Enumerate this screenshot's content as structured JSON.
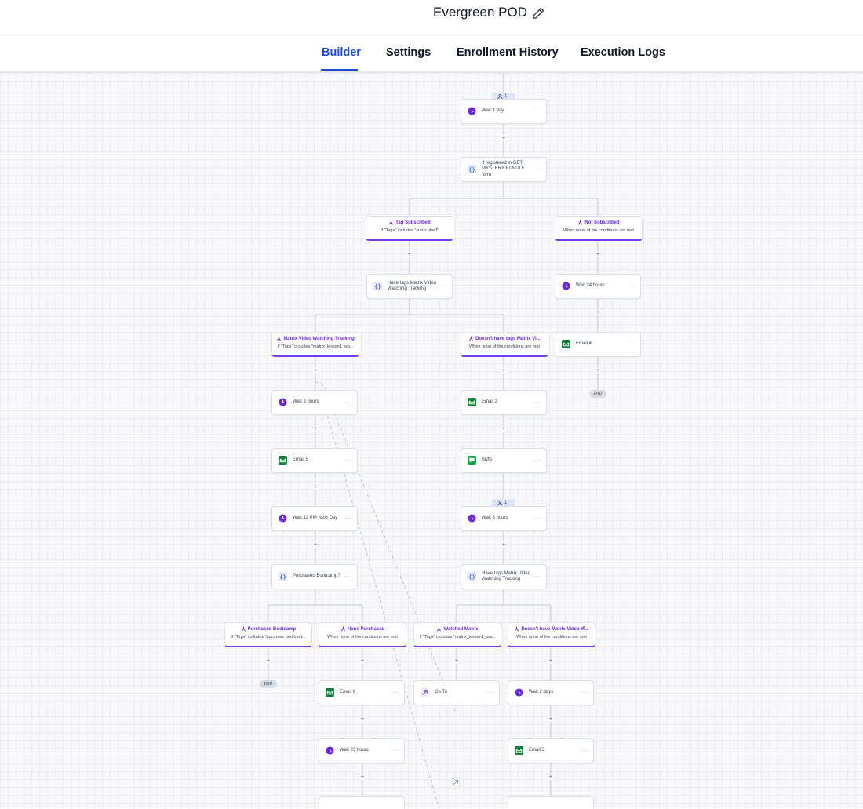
{
  "header": {
    "title": "Evergreen POD",
    "edit_icon": "pencil-icon"
  },
  "tabs": [
    {
      "label": "Builder",
      "active": true
    },
    {
      "label": "Settings",
      "active": false
    },
    {
      "label": "Enrollment History",
      "active": false
    },
    {
      "label": "Execution Logs",
      "active": false
    }
  ],
  "colors": {
    "accent": "#1d4ed8",
    "condition": "#7c3aed",
    "wait": "#6d28d9",
    "email": "#15803d",
    "sms": "#16a34a"
  },
  "workflow": {
    "badges": [
      "1",
      "1"
    ],
    "plus_symbol": "+",
    "end_label": "END",
    "more_symbol": "···",
    "nodes": {
      "wait_1_day": "Wait 1 day",
      "if_registered": "If registered in GET MYSTERY BUNDLE form",
      "have_tags_1": "Have tags Matrix Video Watching Tracking",
      "wait_24_hours": "Wait 24 hours",
      "email_4": "Email 4",
      "wait_3_hours_left": "Wait 3 hours",
      "email_5": "Email 5",
      "wait_12pm": "Wait 12 PM Next Day",
      "purchased_bootcamp_q": "Purchased Bootcamp?",
      "email_2": "Email 2",
      "sms": "SMS",
      "wait_3_hours_mid": "Wait 3 hours",
      "have_tags_2": "Have tags Matrix Video Watching Tracking",
      "email_6": "Email 6",
      "wait_23_hours": "Wait 23 hours",
      "go_to": "Go To",
      "wait_2_days": "Wait 2 days",
      "email_3": "Email 3"
    },
    "branches": {
      "tag_subscribed": {
        "title": "Tag Subscribed",
        "sub": "If \"Tags\" includes \"subscribed\""
      },
      "not_subscribed": {
        "title": "Not Subscribed",
        "sub": "When none of the conditions are met"
      },
      "matrix_tracking": {
        "title": "Matrix Video Watching Tracking",
        "sub": "If \"Tags\" includes \"matrix_lesson1_wa..."
      },
      "doesnt_have_tags": {
        "title": "Doesn't have tags Matrix Vi...",
        "sub": "When none of the conditions are met"
      },
      "purchased_bootcamp": {
        "title": "Purchased Bootcamp",
        "sub": "If \"Tags\" includes \"purchase pod boot..."
      },
      "none_purchased": {
        "title": "None Purchased",
        "sub": "When none of the conditions are met"
      },
      "watched_matrix": {
        "title": "Watched Matrix",
        "sub": "If \"Tags\" includes \"matrix_lesson1_wa..."
      },
      "doesnt_have_matrix": {
        "title": "Doesn't have Matrix Video W...",
        "sub": "When none of the conditions are met"
      }
    }
  }
}
